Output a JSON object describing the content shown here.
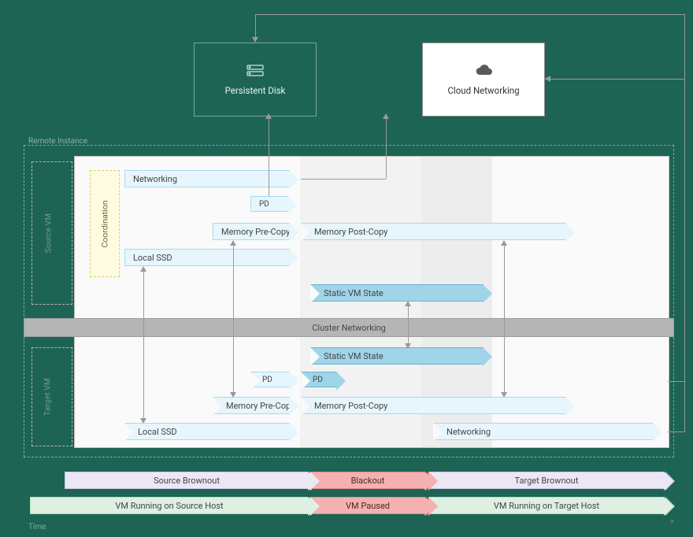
{
  "services": {
    "persistent_disk": {
      "label": "Persistent Disk",
      "icon": "disk-icon"
    },
    "cloud_networking": {
      "label": "Cloud Networking",
      "icon": "cloud-icon"
    }
  },
  "containers": {
    "remote_instance": "Remote Instance",
    "source_vm": "Source VM",
    "target_vm": "Target VM",
    "panel": ""
  },
  "coordination": {
    "label": "Coordination"
  },
  "cluster_networking": {
    "label": "Cluster Networking"
  },
  "source": {
    "networking": {
      "label": "Networking"
    },
    "pd": {
      "label": "PD"
    },
    "mem_pre": {
      "label": "Memory Pre-Copy"
    },
    "mem_post": {
      "label": "Memory Post-Copy"
    },
    "local_ssd": {
      "label": "Local SSD"
    },
    "static_vm_state": {
      "label": "Static VM State"
    }
  },
  "target": {
    "static_vm_state": {
      "label": "Static VM State"
    },
    "pd_pre": {
      "label": "PD"
    },
    "pd_post": {
      "label": "PD"
    },
    "mem_pre": {
      "label": "Memory Pre-Copy"
    },
    "mem_post": {
      "label": "Memory Post-Copy"
    },
    "local_ssd": {
      "label": "Local SSD"
    },
    "networking": {
      "label": "Networking"
    }
  },
  "phases": {
    "brownout_src": {
      "label": "Source Brownout"
    },
    "blackout": {
      "label": "Blackout"
    },
    "brownout_tgt": {
      "label": "Target Brownout"
    },
    "run_src": {
      "label": "VM Running on Source Host"
    },
    "paused": {
      "label": "VM Paused"
    },
    "run_tgt": {
      "label": "VM Running on Target Host"
    }
  },
  "axes": {
    "x": "Time",
    "tick": ">"
  },
  "colors": {
    "bg": "#1d6454",
    "banner_blue": "#e6f6fc",
    "banner_dblue": "#a0d4e8",
    "banner_lilac": "#ece7f5",
    "banner_red": "#f4b1af",
    "banner_green": "#dff0e3",
    "cluster_band": "#b5b5b5",
    "coord": "#fffbe0"
  }
}
